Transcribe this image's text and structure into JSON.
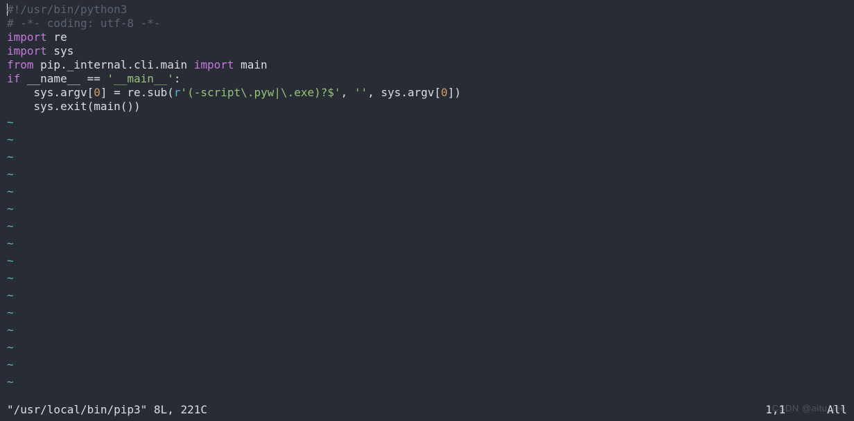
{
  "code": {
    "line1_shebang": "#!/usr/bin/python3",
    "line2_coding": "# -*- coding: utf-8 -*-",
    "line3_import": "import",
    "line3_re": " re",
    "line4_import": "import",
    "line4_sys": " sys",
    "line5_from": "from",
    "line5_pkg": " pip._internal.cli.main ",
    "line5_import": "import",
    "line5_main": " main",
    "line6_if": "if",
    "line6_name": " __name__ == ",
    "line6_str": "'__main__'",
    "line6_colon": ":",
    "line7_pre": "    sys.argv[",
    "line7_zero1": "0",
    "line7_mid1": "] = re.sub(",
    "line7_r": "r",
    "line7_regex": "'(-script\\.pyw|\\.exe)?$'",
    "line7_mid2": ", ",
    "line7_empty": "''",
    "line7_mid3": ", sys.argv[",
    "line7_zero2": "0",
    "line7_end": "])",
    "line8": "    sys.exit(main())"
  },
  "tilde": "~",
  "tilde_count": 16,
  "status": {
    "file_info": "\"/usr/local/bin/pip3\" 8L, 221C",
    "position": "1,1",
    "scroll": "All"
  },
  "watermark": "CSDN @aitu_lee"
}
